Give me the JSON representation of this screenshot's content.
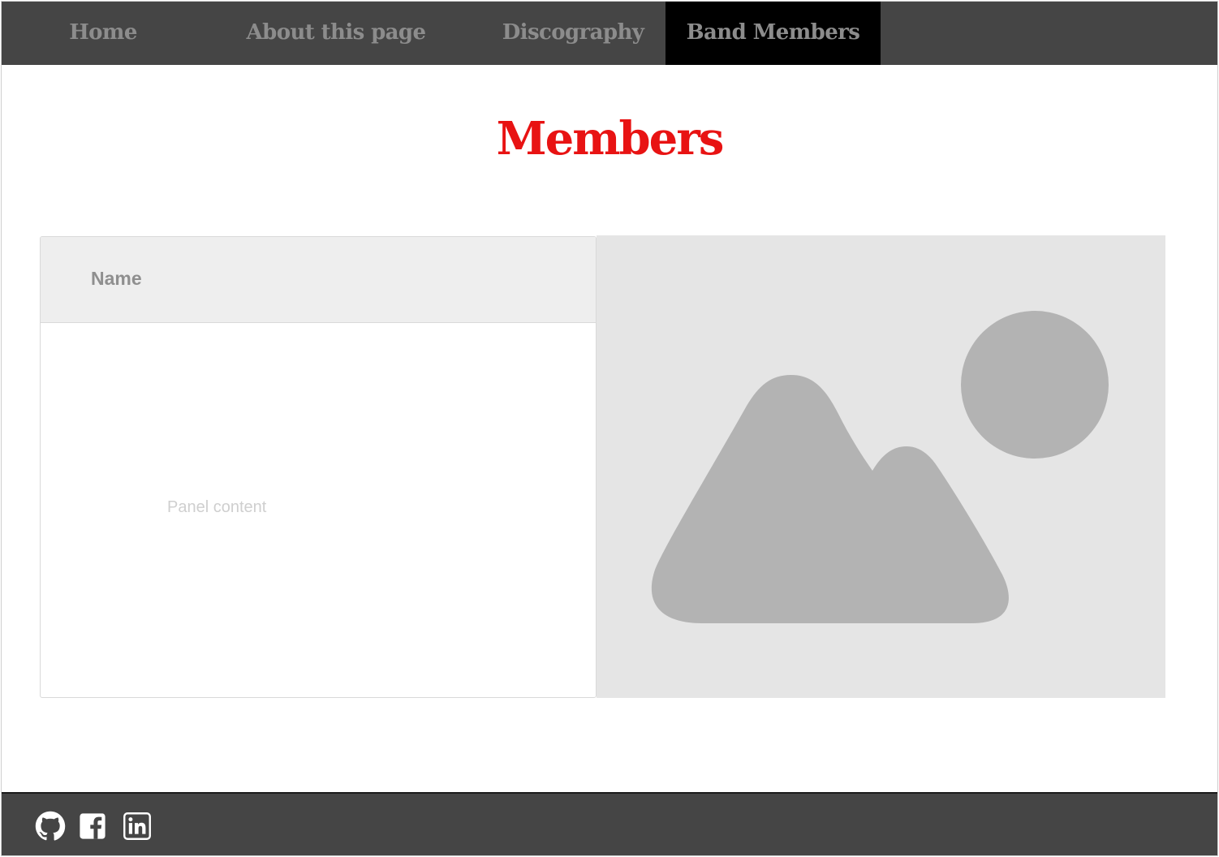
{
  "nav": {
    "items": [
      {
        "label": "Home"
      },
      {
        "label": "About this page"
      },
      {
        "label": "Discography"
      },
      {
        "label": "Band Members"
      }
    ],
    "active_index": 3
  },
  "main": {
    "title": "Members",
    "panel": {
      "header_label": "Name",
      "content": "Panel content"
    },
    "image_placeholder_icon": "image-placeholder-icon"
  },
  "footer": {
    "social_icons": [
      "github-icon",
      "facebook-icon",
      "linkedin-icon"
    ]
  },
  "colors": {
    "title": "#e81313",
    "nav_background": "#454545",
    "nav_active": "#000000",
    "nav_text": "#8c8c8c",
    "panel_header": "#eeeeee",
    "image_placeholder": "#e5e5e5"
  }
}
